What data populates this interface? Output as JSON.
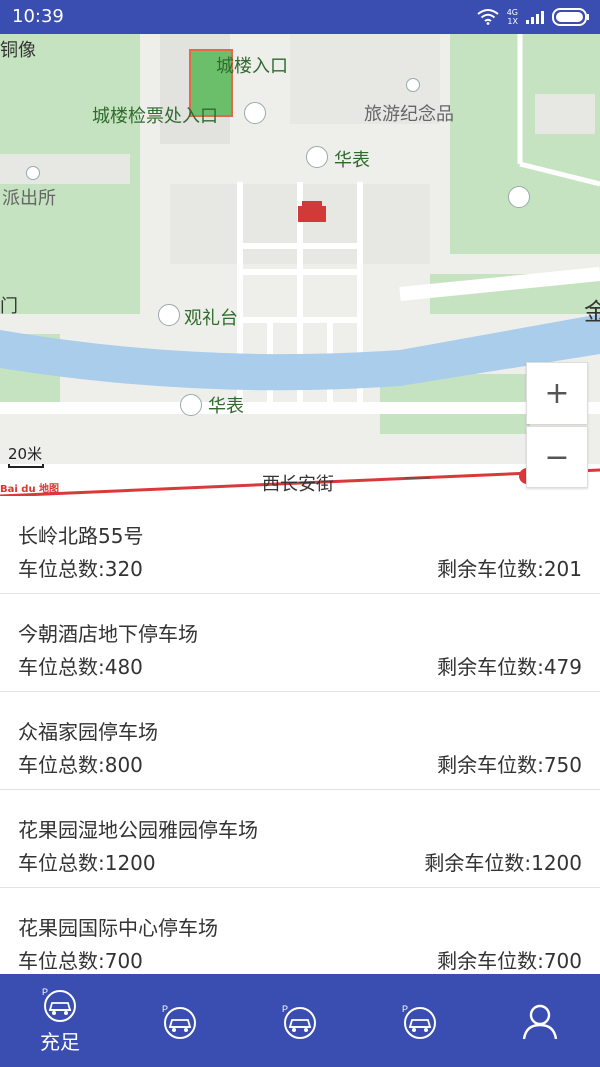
{
  "status_bar": {
    "time": "10:39",
    "network_top": "4G",
    "network_bottom": "1X"
  },
  "map": {
    "pois": [
      {
        "id": "tongxiang",
        "label": "铜像"
      },
      {
        "id": "chenglou_entrance",
        "label": "城楼入口"
      },
      {
        "id": "ticket_entrance",
        "label": "城楼检票处入口"
      },
      {
        "id": "souvenir",
        "label": "旅游纪念品"
      },
      {
        "id": "huabiao_1",
        "label": "华表"
      },
      {
        "id": "police",
        "label": "派出所"
      },
      {
        "id": "men",
        "label": "门"
      },
      {
        "id": "guanlitai",
        "label": "观礼台"
      },
      {
        "id": "huabiao_2",
        "label": "华表"
      },
      {
        "id": "street",
        "label": "西长安街"
      },
      {
        "id": "jin",
        "label": "金"
      }
    ],
    "scale_label": "20米",
    "zoom_in": "+",
    "zoom_out": "−",
    "logo_text": "Bai du 地图"
  },
  "parking_list": [
    {
      "name": "长岭北路55号",
      "total": "车位总数:320",
      "remaining": "剩余车位数:201"
    },
    {
      "name": "今朝酒店地下停车场",
      "total": "车位总数:480",
      "remaining": "剩余车位数:479"
    },
    {
      "name": "众福家园停车场",
      "total": "车位总数:800",
      "remaining": "剩余车位数:750"
    },
    {
      "name": "花果园湿地公园雅园停车场",
      "total": "车位总数:1200",
      "remaining": "剩余车位数:1200"
    },
    {
      "name": "花果园国际中心停车场",
      "total": "车位总数:700",
      "remaining": "剩余车位数:700"
    }
  ],
  "bottom_nav": [
    {
      "id": "chongzu",
      "label": "充足",
      "icon": "parking-car-icon",
      "selected": true
    },
    {
      "id": "tab2",
      "label": "",
      "icon": "parking-car-icon"
    },
    {
      "id": "tab3",
      "label": "",
      "icon": "parking-car-icon"
    },
    {
      "id": "tab4",
      "label": "",
      "icon": "parking-car-icon"
    },
    {
      "id": "profile",
      "label": "",
      "icon": "user-icon"
    }
  ],
  "colors": {
    "primary": "#3a4db0",
    "water": "#a9cdea",
    "park": "#c5e3c0",
    "route": "#d9393a"
  }
}
